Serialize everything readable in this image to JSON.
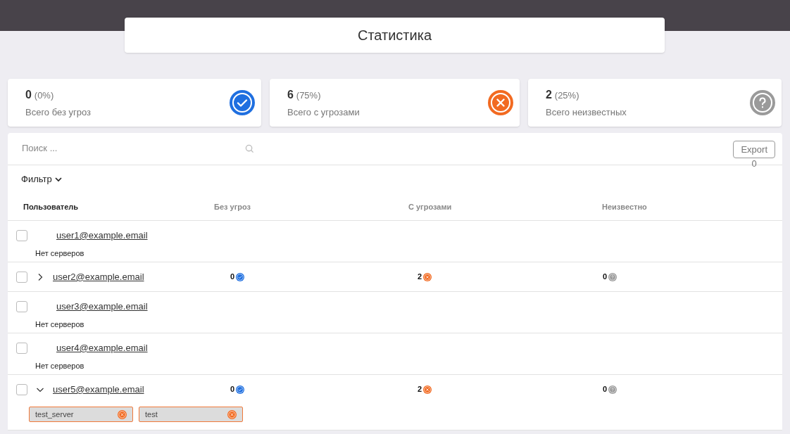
{
  "header": {
    "title": "Статистика"
  },
  "summary": [
    {
      "kind": "safe",
      "count": "0",
      "percent": "(0%)",
      "label": "Всего без угроз"
    },
    {
      "kind": "threat",
      "count": "6",
      "percent": "(75%)",
      "label": "Всего с угрозами"
    },
    {
      "kind": "unknown",
      "count": "2",
      "percent": "(25%)",
      "label": "Всего неизвестных"
    }
  ],
  "toolbar": {
    "search": {
      "placeholder": "Поиск ..."
    },
    "export_button": "Export",
    "export_count": "0",
    "filter": "Фильтр"
  },
  "table": {
    "columns": [
      "Пользователь",
      "Без угроз",
      "С угрозами",
      "Неизвестно"
    ],
    "rows": [
      {
        "checked": false,
        "email": "user1@example.email",
        "note": "Нет серверов"
      },
      {
        "checked": false,
        "expanded": false,
        "email": "user2@example.email",
        "stats": [
          {
            "kind": "safe",
            "value": "0"
          },
          {
            "kind": "threat",
            "value": "2"
          },
          {
            "kind": "unknown",
            "value": "0"
          }
        ]
      },
      {
        "checked": false,
        "email": "user3@example.email",
        "note": "Нет серверов"
      },
      {
        "checked": false,
        "email": "user4@example.email",
        "note": "Нет серверов"
      },
      {
        "checked": false,
        "expanded": true,
        "email": "user5@example.email",
        "stats": [
          {
            "kind": "safe",
            "value": "0"
          },
          {
            "kind": "threat",
            "value": "2"
          },
          {
            "kind": "unknown",
            "value": "0"
          }
        ],
        "servers": [
          {
            "name": "test_server",
            "kind": "threat"
          },
          {
            "name": "test",
            "kind": "threat"
          }
        ]
      }
    ]
  }
}
